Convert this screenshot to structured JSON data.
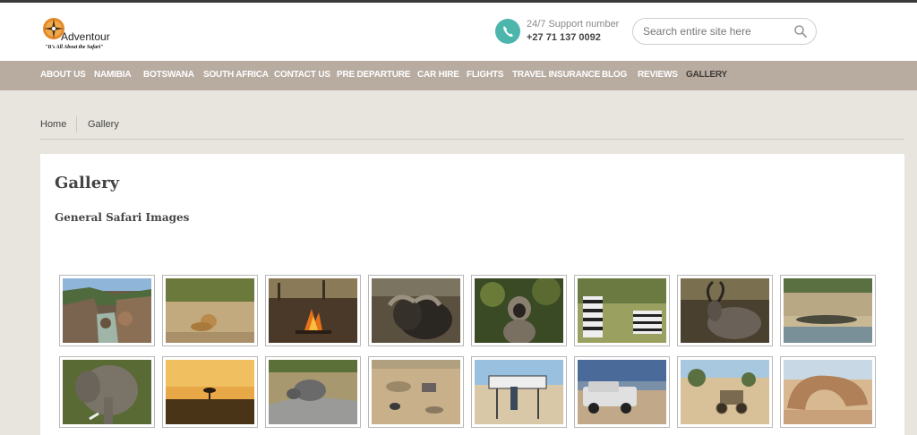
{
  "header": {
    "logo": {
      "name": "Adventour",
      "tagline": "\"It's All About the Safari\""
    },
    "support": {
      "label": "24/7 Support number",
      "number": "+27 71 137 0092"
    },
    "search": {
      "placeholder": "Search entire site here"
    }
  },
  "nav": {
    "items": [
      {
        "label": "ABOUT US",
        "active": false
      },
      {
        "label": "NAMIBIA",
        "active": false
      },
      {
        "label": "BOTSWANA",
        "active": false
      },
      {
        "label": "SOUTH AFRICA",
        "active": false
      },
      {
        "label": "CONTACT US",
        "active": false
      },
      {
        "label": "PRE DEPARTURE",
        "active": false
      },
      {
        "label": "CAR HIRE",
        "active": false
      },
      {
        "label": "FLIGHTS",
        "active": false
      },
      {
        "label": "TRAVEL INSURANCE",
        "active": false
      },
      {
        "label": "BLOG",
        "active": false
      },
      {
        "label": "REVIEWS",
        "active": false
      },
      {
        "label": "GALLERY",
        "active": true
      }
    ]
  },
  "breadcrumb": {
    "home": "Home",
    "current": "Gallery"
  },
  "main": {
    "title": "Gallery",
    "section": "General Safari Images"
  },
  "gallery": {
    "images": [
      {
        "name": "canyon-river"
      },
      {
        "name": "lion-grass"
      },
      {
        "name": "campfire"
      },
      {
        "name": "buffalo"
      },
      {
        "name": "vervet-monkey"
      },
      {
        "name": "zebras"
      },
      {
        "name": "kudu"
      },
      {
        "name": "crocodile-riverbank"
      },
      {
        "name": "elephant"
      },
      {
        "name": "savanna-sunset"
      },
      {
        "name": "rhino-road"
      },
      {
        "name": "desert-camp"
      },
      {
        "name": "tropic-sign"
      },
      {
        "name": "pickup-truck-beach"
      },
      {
        "name": "old-car-desert"
      },
      {
        "name": "rock-formation"
      }
    ]
  },
  "colors": {
    "nav_bg": "#b8aca1",
    "accent": "#4db6ac",
    "page_bg": "#e8e5df"
  }
}
